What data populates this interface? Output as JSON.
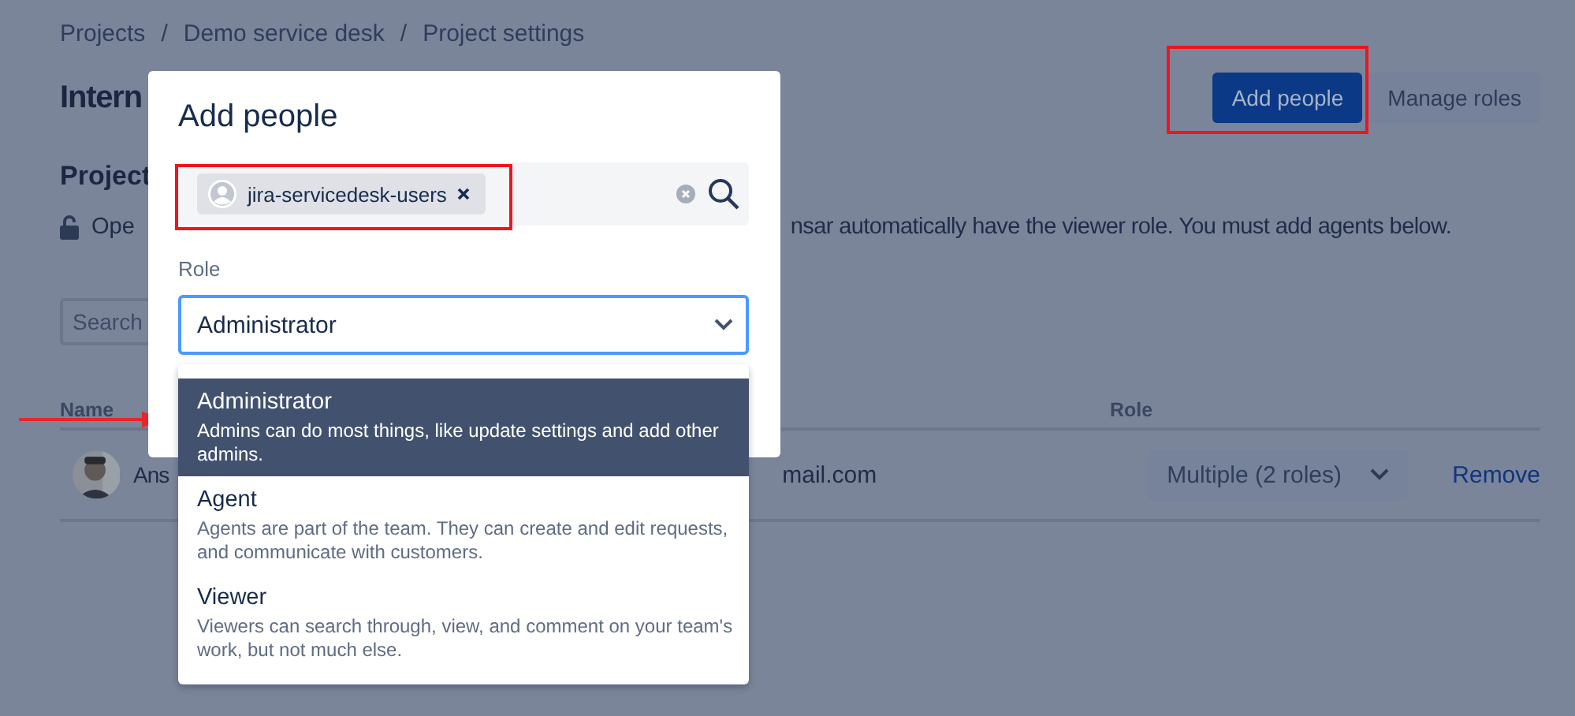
{
  "breadcrumbs": {
    "separator": "/",
    "items": [
      "Projects",
      "Demo service desk",
      "Project settings"
    ]
  },
  "page_title": "Intern",
  "header_buttons": [
    {
      "label": "Add people",
      "kind": "primary"
    },
    {
      "label": "Manage roles",
      "kind": "secondary"
    }
  ],
  "section_title": "Project",
  "access_note": {
    "start": "Ope",
    "end": "nsar automatically have the viewer role. You must add agents below."
  },
  "search": {
    "placeholder": "Search"
  },
  "table": {
    "columns": [
      "Name",
      "Role"
    ],
    "rows": [
      {
        "name": "Ans",
        "email": "mail.com",
        "role": "Multiple (2 roles)",
        "action": "Remove"
      }
    ]
  },
  "dialog": {
    "title": "Add people",
    "chips": [
      "jira-servicedesk-users"
    ],
    "role_label": "Role",
    "role_value": "Administrator",
    "options": [
      {
        "label": "Administrator",
        "description": "Admins can do most things, like update settings and add other admins.",
        "selected": true
      },
      {
        "label": "Agent",
        "description": "Agents are part of the team. They can create and edit requests, and communicate with customers.",
        "selected": false
      },
      {
        "label": "Viewer",
        "description": "Viewers can search through, view, and comment on your team's work, but not much else.",
        "selected": false
      }
    ]
  }
}
